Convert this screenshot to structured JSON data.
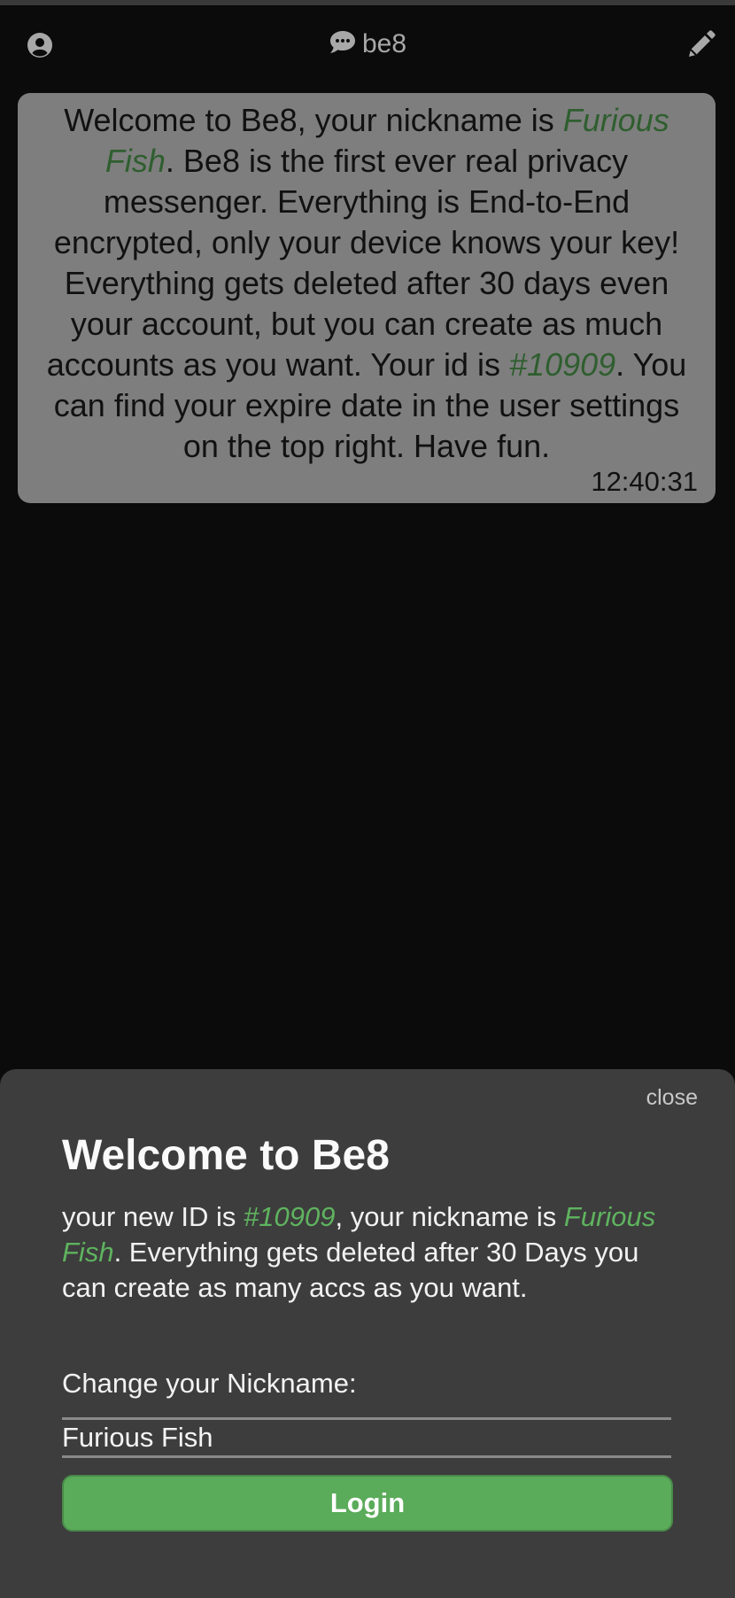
{
  "header": {
    "title": "be8",
    "avatar_icon": "user-circle-icon",
    "chat_icon": "chat-bubble-icon",
    "edit_icon": "pencil-icon"
  },
  "message": {
    "part1": "Welcome to Be8, your nickname is ",
    "nickname": "Furious Fish",
    "part2": ". Be8 is the first ever real privacy messenger. Everything is End-to-End encrypted, only your device knows your key! Everything gets deleted after 30 days even your account, but you can create as much accounts as you want. Your id is ",
    "id": "#10909",
    "part3": ". You can find your expire date in the user settings on the top right. Have fun.",
    "time": "12:40:31"
  },
  "sheet": {
    "close_label": "close",
    "title": "Welcome to Be8",
    "desc_part1": "your new ID is ",
    "id": "#10909",
    "desc_part2": ", your nickname is ",
    "nickname": "Furious Fish",
    "desc_part3": ". Everything gets deleted after 30 Days you can create as many accs as you want.",
    "nickname_label": "Change your Nickname:",
    "nickname_value": "Furious Fish",
    "login_label": "Login"
  },
  "colors": {
    "highlight_dark": "#2f5e2f",
    "highlight_light": "#5fb35f",
    "button": "#5aab5a"
  }
}
